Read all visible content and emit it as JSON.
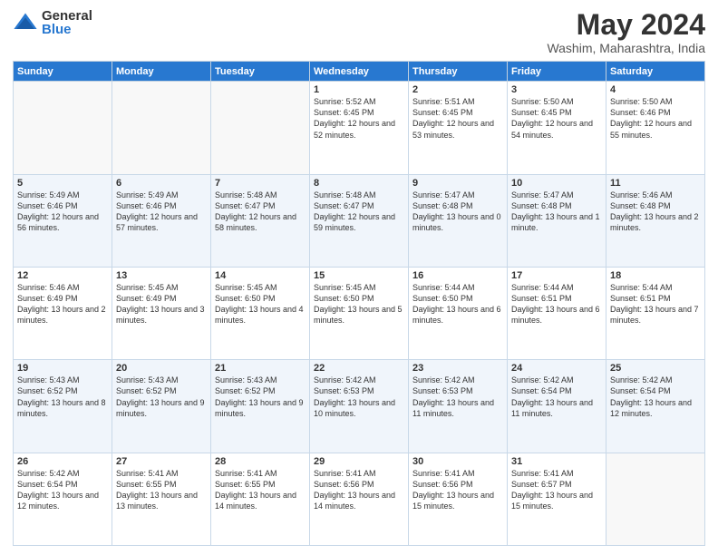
{
  "logo": {
    "general": "General",
    "blue": "Blue"
  },
  "title": {
    "month": "May 2024",
    "location": "Washim, Maharashtra, India"
  },
  "weekdays": [
    "Sunday",
    "Monday",
    "Tuesday",
    "Wednesday",
    "Thursday",
    "Friday",
    "Saturday"
  ],
  "weeks": [
    [
      {
        "day": "",
        "info": ""
      },
      {
        "day": "",
        "info": ""
      },
      {
        "day": "",
        "info": ""
      },
      {
        "day": "1",
        "info": "Sunrise: 5:52 AM\nSunset: 6:45 PM\nDaylight: 12 hours\nand 52 minutes."
      },
      {
        "day": "2",
        "info": "Sunrise: 5:51 AM\nSunset: 6:45 PM\nDaylight: 12 hours\nand 53 minutes."
      },
      {
        "day": "3",
        "info": "Sunrise: 5:50 AM\nSunset: 6:45 PM\nDaylight: 12 hours\nand 54 minutes."
      },
      {
        "day": "4",
        "info": "Sunrise: 5:50 AM\nSunset: 6:46 PM\nDaylight: 12 hours\nand 55 minutes."
      }
    ],
    [
      {
        "day": "5",
        "info": "Sunrise: 5:49 AM\nSunset: 6:46 PM\nDaylight: 12 hours\nand 56 minutes."
      },
      {
        "day": "6",
        "info": "Sunrise: 5:49 AM\nSunset: 6:46 PM\nDaylight: 12 hours\nand 57 minutes."
      },
      {
        "day": "7",
        "info": "Sunrise: 5:48 AM\nSunset: 6:47 PM\nDaylight: 12 hours\nand 58 minutes."
      },
      {
        "day": "8",
        "info": "Sunrise: 5:48 AM\nSunset: 6:47 PM\nDaylight: 12 hours\nand 59 minutes."
      },
      {
        "day": "9",
        "info": "Sunrise: 5:47 AM\nSunset: 6:48 PM\nDaylight: 13 hours\nand 0 minutes."
      },
      {
        "day": "10",
        "info": "Sunrise: 5:47 AM\nSunset: 6:48 PM\nDaylight: 13 hours\nand 1 minute."
      },
      {
        "day": "11",
        "info": "Sunrise: 5:46 AM\nSunset: 6:48 PM\nDaylight: 13 hours\nand 2 minutes."
      }
    ],
    [
      {
        "day": "12",
        "info": "Sunrise: 5:46 AM\nSunset: 6:49 PM\nDaylight: 13 hours\nand 2 minutes."
      },
      {
        "day": "13",
        "info": "Sunrise: 5:45 AM\nSunset: 6:49 PM\nDaylight: 13 hours\nand 3 minutes."
      },
      {
        "day": "14",
        "info": "Sunrise: 5:45 AM\nSunset: 6:50 PM\nDaylight: 13 hours\nand 4 minutes."
      },
      {
        "day": "15",
        "info": "Sunrise: 5:45 AM\nSunset: 6:50 PM\nDaylight: 13 hours\nand 5 minutes."
      },
      {
        "day": "16",
        "info": "Sunrise: 5:44 AM\nSunset: 6:50 PM\nDaylight: 13 hours\nand 6 minutes."
      },
      {
        "day": "17",
        "info": "Sunrise: 5:44 AM\nSunset: 6:51 PM\nDaylight: 13 hours\nand 6 minutes."
      },
      {
        "day": "18",
        "info": "Sunrise: 5:44 AM\nSunset: 6:51 PM\nDaylight: 13 hours\nand 7 minutes."
      }
    ],
    [
      {
        "day": "19",
        "info": "Sunrise: 5:43 AM\nSunset: 6:52 PM\nDaylight: 13 hours\nand 8 minutes."
      },
      {
        "day": "20",
        "info": "Sunrise: 5:43 AM\nSunset: 6:52 PM\nDaylight: 13 hours\nand 9 minutes."
      },
      {
        "day": "21",
        "info": "Sunrise: 5:43 AM\nSunset: 6:52 PM\nDaylight: 13 hours\nand 9 minutes."
      },
      {
        "day": "22",
        "info": "Sunrise: 5:42 AM\nSunset: 6:53 PM\nDaylight: 13 hours\nand 10 minutes."
      },
      {
        "day": "23",
        "info": "Sunrise: 5:42 AM\nSunset: 6:53 PM\nDaylight: 13 hours\nand 11 minutes."
      },
      {
        "day": "24",
        "info": "Sunrise: 5:42 AM\nSunset: 6:54 PM\nDaylight: 13 hours\nand 11 minutes."
      },
      {
        "day": "25",
        "info": "Sunrise: 5:42 AM\nSunset: 6:54 PM\nDaylight: 13 hours\nand 12 minutes."
      }
    ],
    [
      {
        "day": "26",
        "info": "Sunrise: 5:42 AM\nSunset: 6:54 PM\nDaylight: 13 hours\nand 12 minutes."
      },
      {
        "day": "27",
        "info": "Sunrise: 5:41 AM\nSunset: 6:55 PM\nDaylight: 13 hours\nand 13 minutes."
      },
      {
        "day": "28",
        "info": "Sunrise: 5:41 AM\nSunset: 6:55 PM\nDaylight: 13 hours\nand 14 minutes."
      },
      {
        "day": "29",
        "info": "Sunrise: 5:41 AM\nSunset: 6:56 PM\nDaylight: 13 hours\nand 14 minutes."
      },
      {
        "day": "30",
        "info": "Sunrise: 5:41 AM\nSunset: 6:56 PM\nDaylight: 13 hours\nand 15 minutes."
      },
      {
        "day": "31",
        "info": "Sunrise: 5:41 AM\nSunset: 6:57 PM\nDaylight: 13 hours\nand 15 minutes."
      },
      {
        "day": "",
        "info": ""
      }
    ]
  ]
}
